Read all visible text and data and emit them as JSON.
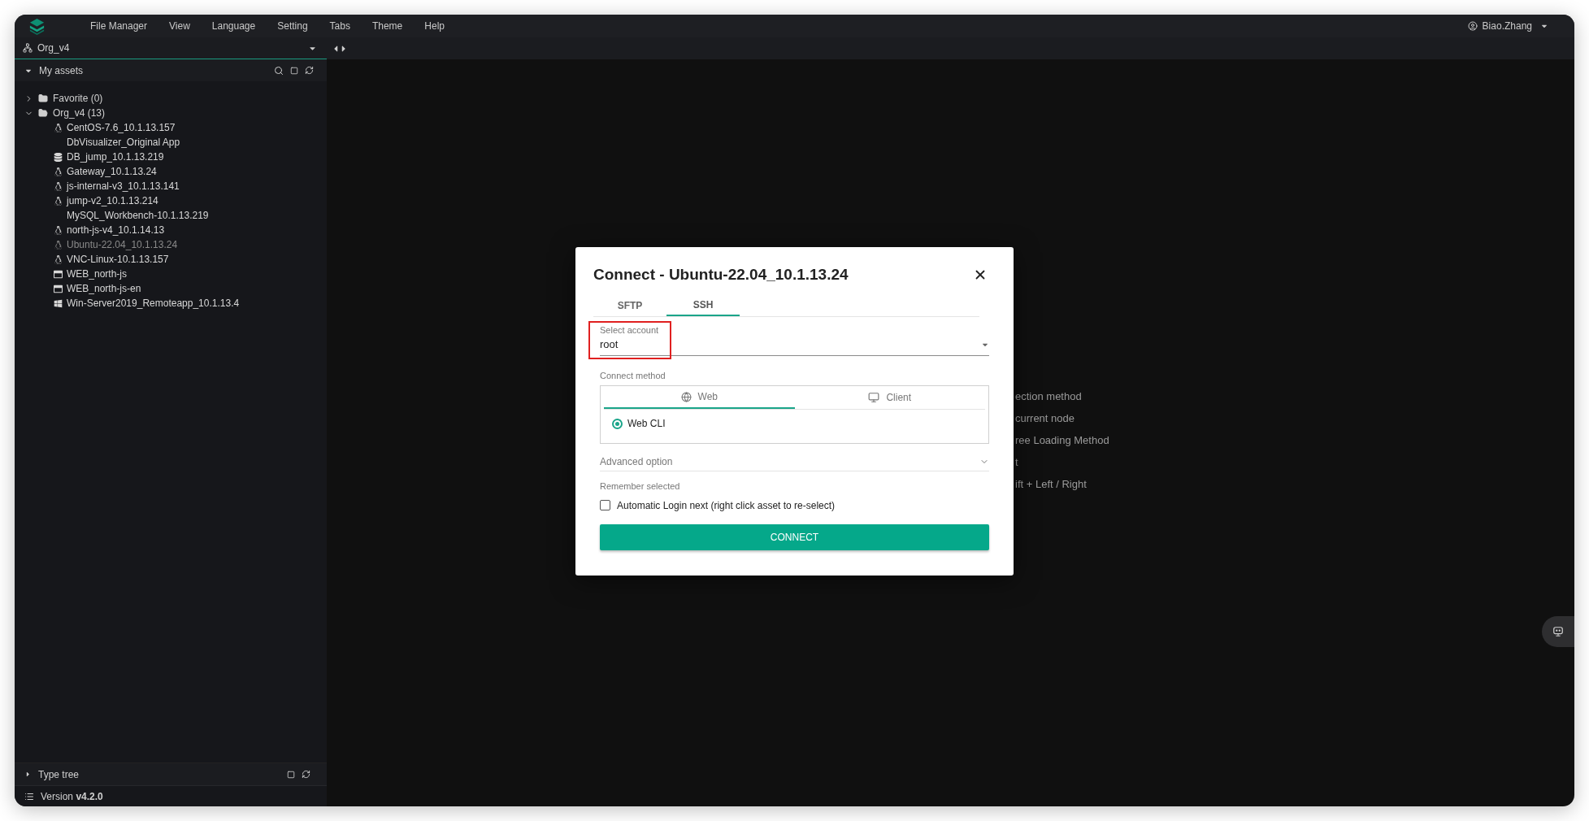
{
  "menu": {
    "items": [
      "File Manager",
      "View",
      "Language",
      "Setting",
      "Tabs",
      "Theme",
      "Help"
    ],
    "user": "Biao.Zhang"
  },
  "sidebar": {
    "org": "Org_v4",
    "assets_title": "My assets",
    "tree": [
      {
        "label": "Favorite (0)",
        "expanded": false
      },
      {
        "label": "Org_v4 (13)",
        "expanded": true,
        "children": [
          {
            "label": "CentOS-7.6_10.1.13.157",
            "kind": "linux",
            "disabled": false
          },
          {
            "label": "DbVisualizer_Original App",
            "kind": "app",
            "disabled": false
          },
          {
            "label": "DB_jump_10.1.13.219",
            "kind": "database",
            "disabled": false
          },
          {
            "label": "Gateway_10.1.13.24",
            "kind": "linux",
            "disabled": false
          },
          {
            "label": "js-internal-v3_10.1.13.141",
            "kind": "linux",
            "disabled": false
          },
          {
            "label": "jump-v2_10.1.13.214",
            "kind": "linux",
            "disabled": false
          },
          {
            "label": "MySQL_Workbench-10.1.13.219",
            "kind": "app",
            "disabled": false
          },
          {
            "label": "north-js-v4_10.1.14.13",
            "kind": "linux",
            "disabled": false
          },
          {
            "label": "Ubuntu-22.04_10.1.13.24",
            "kind": "linux",
            "disabled": true
          },
          {
            "label": "VNC-Linux-10.1.13.157",
            "kind": "linux",
            "disabled": false
          },
          {
            "label": "WEB_north-js",
            "kind": "web",
            "disabled": false
          },
          {
            "label": "WEB_north-js-en",
            "kind": "web",
            "disabled": false
          },
          {
            "label": "Win-Server2019_Remoteapp_10.1.13.4",
            "kind": "windows",
            "disabled": false
          }
        ]
      }
    ],
    "type_tree": "Type tree",
    "version_label": "Version",
    "version": "v4.2.0"
  },
  "hints": [
    "ection method",
    "current node",
    "ree Loading Method",
    "t",
    "ift + Left / Right"
  ],
  "dialog": {
    "title": "Connect - Ubuntu-22.04_10.1.13.24",
    "tabs": [
      {
        "label": "SFTP",
        "selected": false
      },
      {
        "label": "SSH",
        "selected": true
      }
    ],
    "account": {
      "label": "Select account",
      "value": "root",
      "highlighted": true
    },
    "method_label": "Connect method",
    "methods": [
      {
        "label": "Web",
        "kind": "web",
        "selected": true
      },
      {
        "label": "Client",
        "kind": "client",
        "selected": false
      }
    ],
    "options": [
      {
        "label": "Web CLI",
        "selected": true
      }
    ],
    "advanced": "Advanced option",
    "remember_label": "Remember selected",
    "auto_login": {
      "label": "Automatic Login next (right click asset to re-select)",
      "checked": false
    },
    "connect": "CONNECT"
  }
}
